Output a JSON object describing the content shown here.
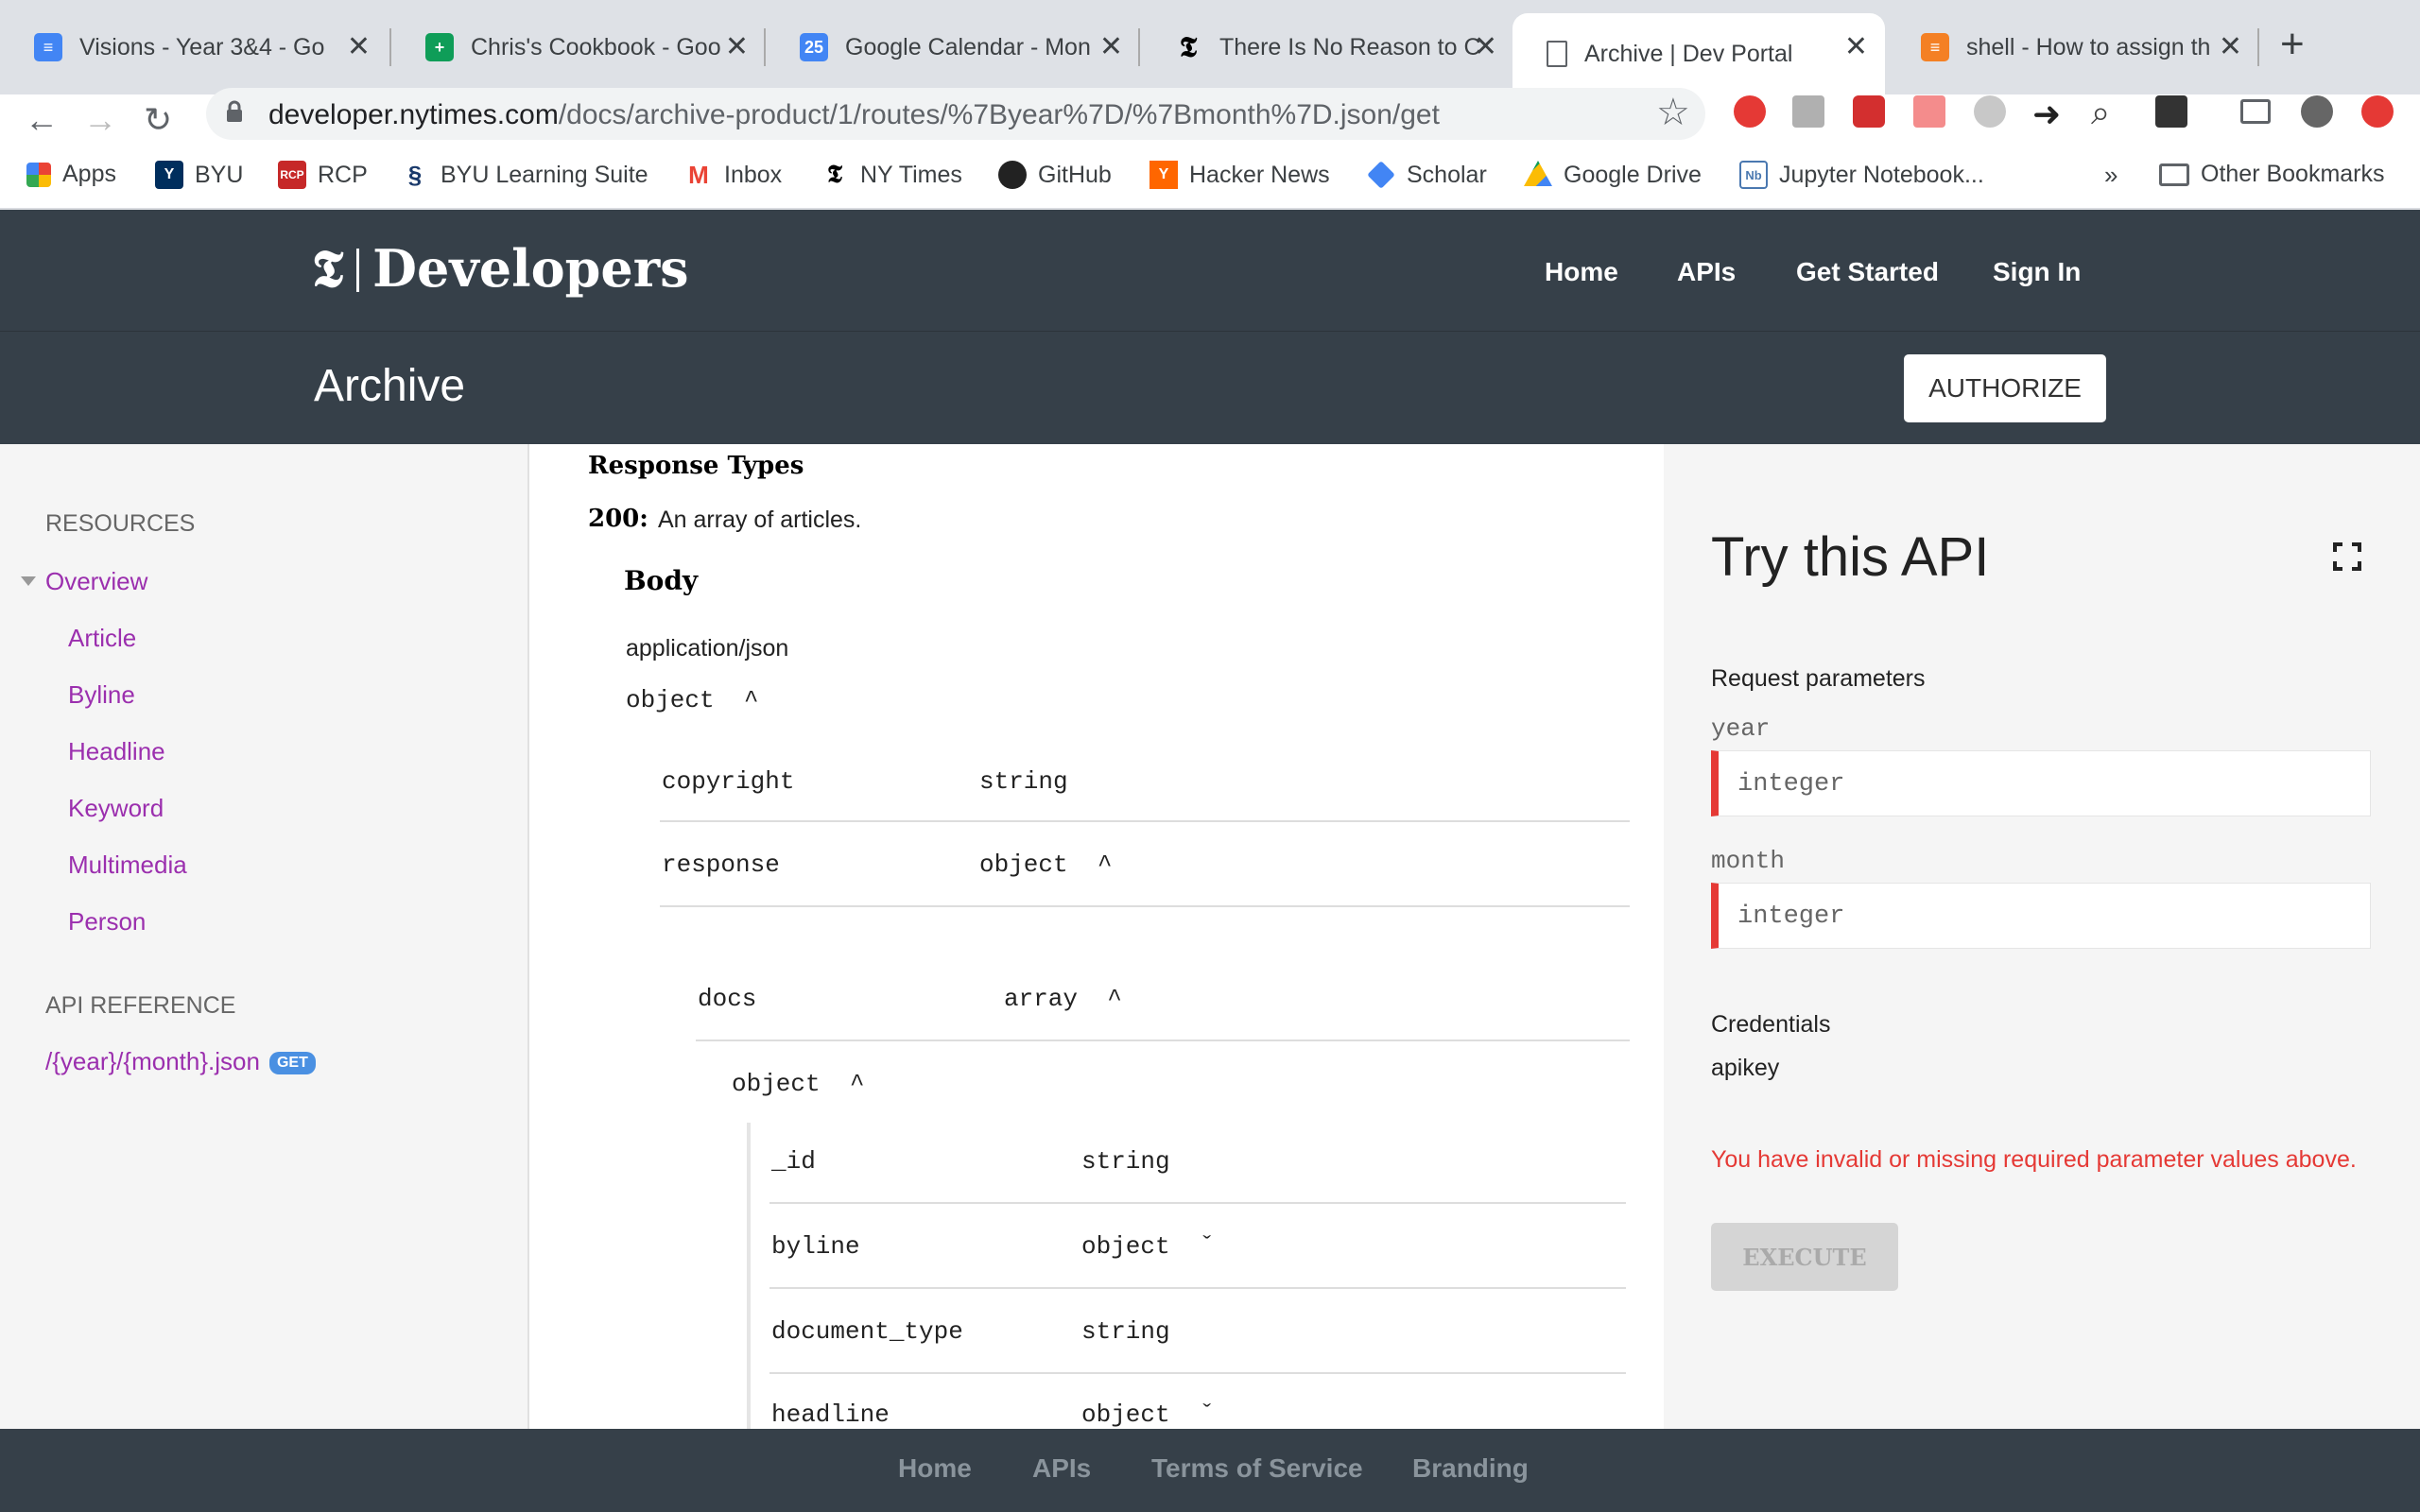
{
  "browser": {
    "tabs": [
      {
        "title": "Visions - Year 3&4 - Go",
        "color": "#4285f4"
      },
      {
        "title": "Chris's Cookbook - Goo",
        "color": "#0f9d58"
      },
      {
        "title": "Google Calendar - Mon",
        "color": "#4285f4",
        "icon_text": "25"
      },
      {
        "title": "There Is No Reason to C",
        "color": "#000000"
      },
      {
        "title": "Archive | Dev Portal",
        "color": "#ffffff",
        "active": true
      },
      {
        "title": "shell - How to assign th",
        "color": "#f48024"
      }
    ],
    "url_host": "developer.nytimes.com",
    "url_path": "/docs/archive-product/1/routes/%7Byear%7D/%7Bmonth%7D.json/get",
    "bookmarks": [
      "Apps",
      "BYU",
      "RCP",
      "BYU Learning Suite",
      "Inbox",
      "NY Times",
      "GitHub",
      "Hacker News",
      "Scholar",
      "Google Drive",
      "Jupyter Notebook...",
      "Other Bookmarks"
    ],
    "overflow": "»"
  },
  "site": {
    "logo_mark": "𝕿",
    "logo_text": "Developers",
    "nav": [
      "Home",
      "APIs",
      "Get Started",
      "Sign In"
    ],
    "page_title": "Archive",
    "authorize_label": "AUTHORIZE"
  },
  "sidebar": {
    "resources_heading": "RESOURCES",
    "overview": "Overview",
    "items": [
      "Article",
      "Byline",
      "Headline",
      "Keyword",
      "Multimedia",
      "Person"
    ],
    "api_heading": "API REFERENCE",
    "endpoint": "/{year}/{month}.json",
    "endpoint_method": "GET"
  },
  "main": {
    "response_types": "Response Types",
    "status_code": "200:",
    "status_desc": "An array of articles.",
    "body_heading": "Body",
    "content_type": "application/json",
    "root_type": "object",
    "caret_up": "^",
    "caret_down": "ˇ",
    "fields_level1": [
      {
        "name": "copyright",
        "type": "string"
      },
      {
        "name": "response",
        "type": "object"
      }
    ],
    "docs_field": {
      "name": "docs",
      "type": "array"
    },
    "docs_item_type": "object",
    "fields_level3": [
      {
        "name": "_id",
        "type": "string"
      },
      {
        "name": "byline",
        "type": "object"
      },
      {
        "name": "document_type",
        "type": "string"
      },
      {
        "name": "headline",
        "type": "object"
      }
    ]
  },
  "try_api": {
    "title": "Try this API",
    "request_params_label": "Request parameters",
    "params": [
      {
        "name": "year",
        "placeholder": "integer"
      },
      {
        "name": "month",
        "placeholder": "integer"
      }
    ],
    "credentials_label": "Credentials",
    "credentials_value": "apikey",
    "error": "You have invalid or missing required parameter values above.",
    "execute_label": "EXECUTE"
  },
  "footer": {
    "links": [
      "Home",
      "APIs",
      "Terms of Service",
      "Branding"
    ]
  }
}
